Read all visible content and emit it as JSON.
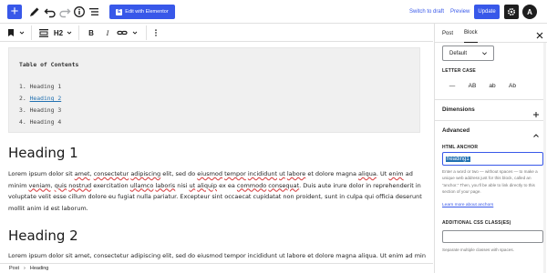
{
  "topbar": {
    "add_block_icon": "plus-icon",
    "edit_with_elementor_label": "Edit with Elementor",
    "elementor_logo_glyph": "E",
    "switch_to_draft_label": "Switch to draft",
    "preview_label": "Preview",
    "update_label": "Update",
    "astra_glyph": "A",
    "accent_color": "#3858e9"
  },
  "block_toolbar": {
    "heading_level_label": "H2"
  },
  "editor": {
    "toc": {
      "title": "Table of Contents",
      "items": [
        {
          "label": "1. Heading 1",
          "num": "1.",
          "text": "Heading 1"
        },
        {
          "label": "2. Heading 2",
          "num": "2.",
          "text": "Heading 2"
        },
        {
          "label": "3. Heading 3",
          "num": "3.",
          "text": "Heading 3"
        },
        {
          "label": "4. Heading 4",
          "num": "4.",
          "text": "Heading 4"
        }
      ]
    },
    "heading1": "Heading 1",
    "paragraph1_parts": [
      "Lorem ipsum dolor sit ",
      "amet",
      ", ",
      "consectetur",
      " ",
      "adipiscing",
      " elit, sed do ",
      "eiusmod",
      " ",
      "tempor",
      " ",
      "incididunt",
      " ",
      "ut",
      " ",
      "labore",
      " et dolore magna ",
      "aliqua",
      ". Ut ",
      "enim",
      " ad minim ",
      "veniam",
      ", ",
      "quis",
      " ",
      "nostrud",
      " exercitation ",
      "ullamco",
      " ",
      "laboris",
      " nisi ",
      "ut",
      " ",
      "aliquip",
      " ex ea ",
      "commodo",
      " ",
      "consequat",
      ". Duis aute irure dolor in reprehenderit in voluptate velit esse cillum dolore eu fugiat nulla pariatur. Excepteur sint occaecat cupidatat non proident, sunt in culpa qui officia deserunt mollit anim id est laborum."
    ],
    "heading2": "Heading 2",
    "paragraph2": "Lorem ipsum dolor sit amet, consectetur adipiscing elit, sed do eiusmod tempor incididunt ut labore et dolore magna aliqua. Ut enim ad minim"
  },
  "footer": {
    "breadcrumb_post": "Post",
    "breadcrumb_sep": "›",
    "breadcrumb_heading": "Heading"
  },
  "sidebar": {
    "tab_post": "Post",
    "tab_block": "Block",
    "style_select_value": "Default",
    "letter_case_label": "LETTER CASE",
    "letter_case_options": [
      "—",
      "AB",
      "ab",
      "Ab"
    ],
    "dimensions_label": "Dimensions",
    "advanced_label": "Advanced",
    "html_anchor_label": "HTML ANCHOR",
    "html_anchor_value": "heading1",
    "anchor_help": "Enter a word or two — without spaces — to make a unique web address just for this block, called an “anchor.” Then, you’ll be able to link directly to this section of your page.",
    "anchor_link": "Learn more about anchors",
    "css_classes_label": "ADDITIONAL CSS CLASS(ES)",
    "css_help": "Separate multiple classes with spaces."
  }
}
